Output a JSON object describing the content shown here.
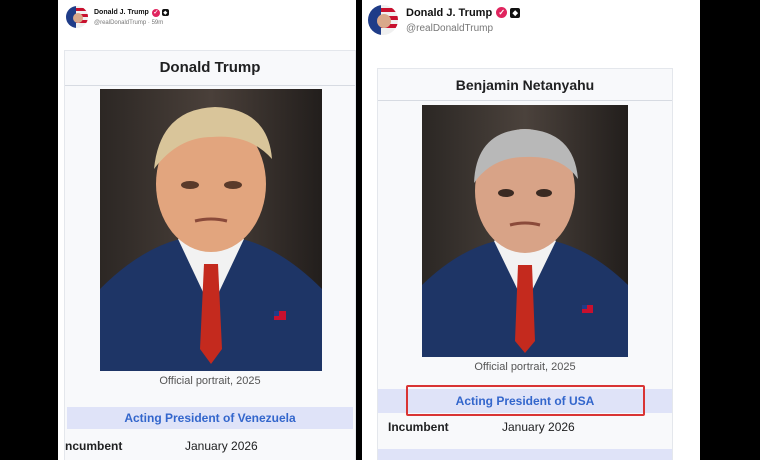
{
  "colors": {
    "background": "#000000",
    "panel": "#ffffff",
    "verified_badge": "#e0245e",
    "office_bar": "#dfe3f8",
    "office_text": "#3366cc",
    "highlight": "#d93434"
  },
  "left_post": {
    "display_name": "Donald J. Trump",
    "verified_icon": "verified-badge-icon",
    "affiliation_icon": "affiliation-badge-icon",
    "handle": "@realDonaldTrump",
    "time": "· 59m",
    "infobox": {
      "title": "Donald Trump",
      "caption": "Official portrait, 2025",
      "office": "Acting President of Venezuela",
      "row_label": "ncumbent",
      "row_value": "January 2026"
    }
  },
  "right_post": {
    "display_name": "Donald J. Trump",
    "verified_icon": "verified-badge-icon",
    "affiliation_icon": "affiliation-badge-icon",
    "handle": "@realDonaldTrump",
    "infobox": {
      "title": "Benjamin Netanyahu",
      "caption": "Official portrait, 2025",
      "office": "Acting President of USA",
      "row_label": "Incumbent",
      "row_value": "January 2026"
    }
  }
}
